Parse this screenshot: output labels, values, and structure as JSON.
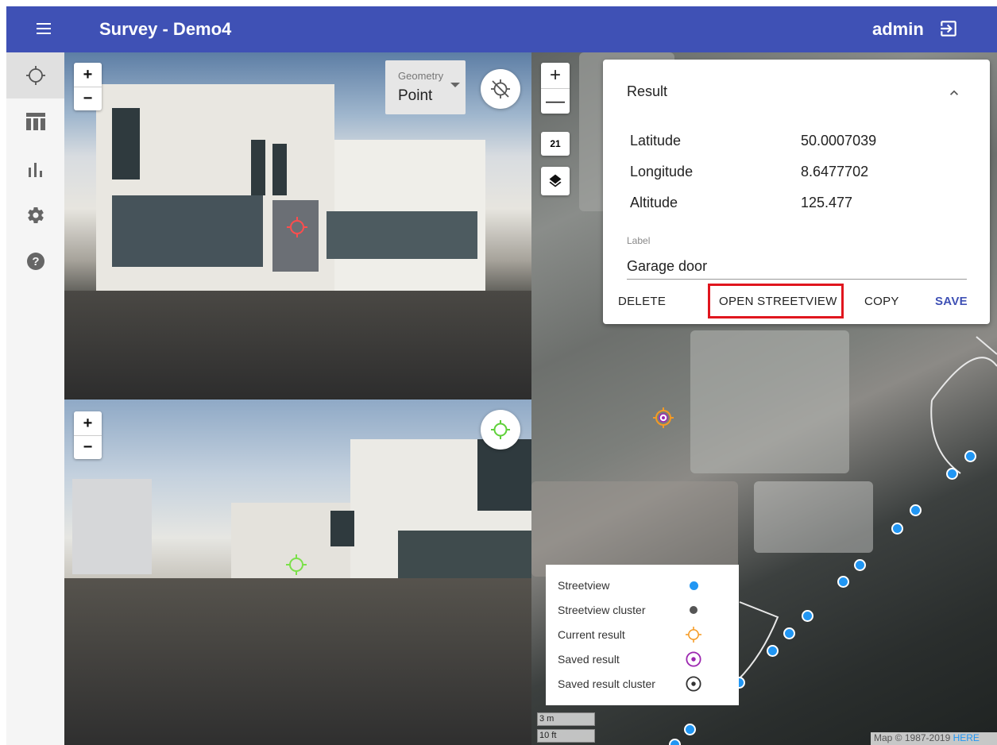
{
  "app": {
    "title": "Survey - Demo4",
    "user": "admin"
  },
  "sidebar": {
    "items": [
      {
        "name": "crosshair-icon",
        "active": true
      },
      {
        "name": "table-icon"
      },
      {
        "name": "chart-icon"
      },
      {
        "name": "settings-icon"
      },
      {
        "name": "help-icon"
      }
    ]
  },
  "streetview": {
    "zoom_in": "+",
    "zoom_out": "−",
    "geometry_label": "Geometry",
    "geometry_value": "Point"
  },
  "map": {
    "zoom_in": "+",
    "zoom_out": "—",
    "zoom_level": "21",
    "scale_m": "3 m",
    "scale_ft": "10 ft",
    "copyright": "Map © 1987-2019",
    "copyright_brand": "HERE"
  },
  "result": {
    "title": "Result",
    "latitude_label": "Latitude",
    "latitude_value": "50.0007039",
    "longitude_label": "Longitude",
    "longitude_value": "8.6477702",
    "altitude_label": "Altitude",
    "altitude_value": "125.477",
    "label_caption": "Label",
    "label_value": "Garage door",
    "actions": {
      "delete": "DELETE",
      "open_streetview": "OPEN STREETVIEW",
      "copy": "COPY",
      "save": "SAVE"
    }
  },
  "legend": {
    "items": [
      {
        "label": "Streetview",
        "color": "#2196f3"
      },
      {
        "label": "Streetview cluster",
        "color": "#555555"
      },
      {
        "label": "Current result",
        "color": "#f59a23"
      },
      {
        "label": "Saved result",
        "color": "#9c27b0"
      },
      {
        "label": "Saved result cluster",
        "color": "#333333"
      }
    ]
  },
  "colors": {
    "primary": "#3f51b5",
    "accent_red": "#e0161e",
    "dot_blue": "#2196f3"
  }
}
